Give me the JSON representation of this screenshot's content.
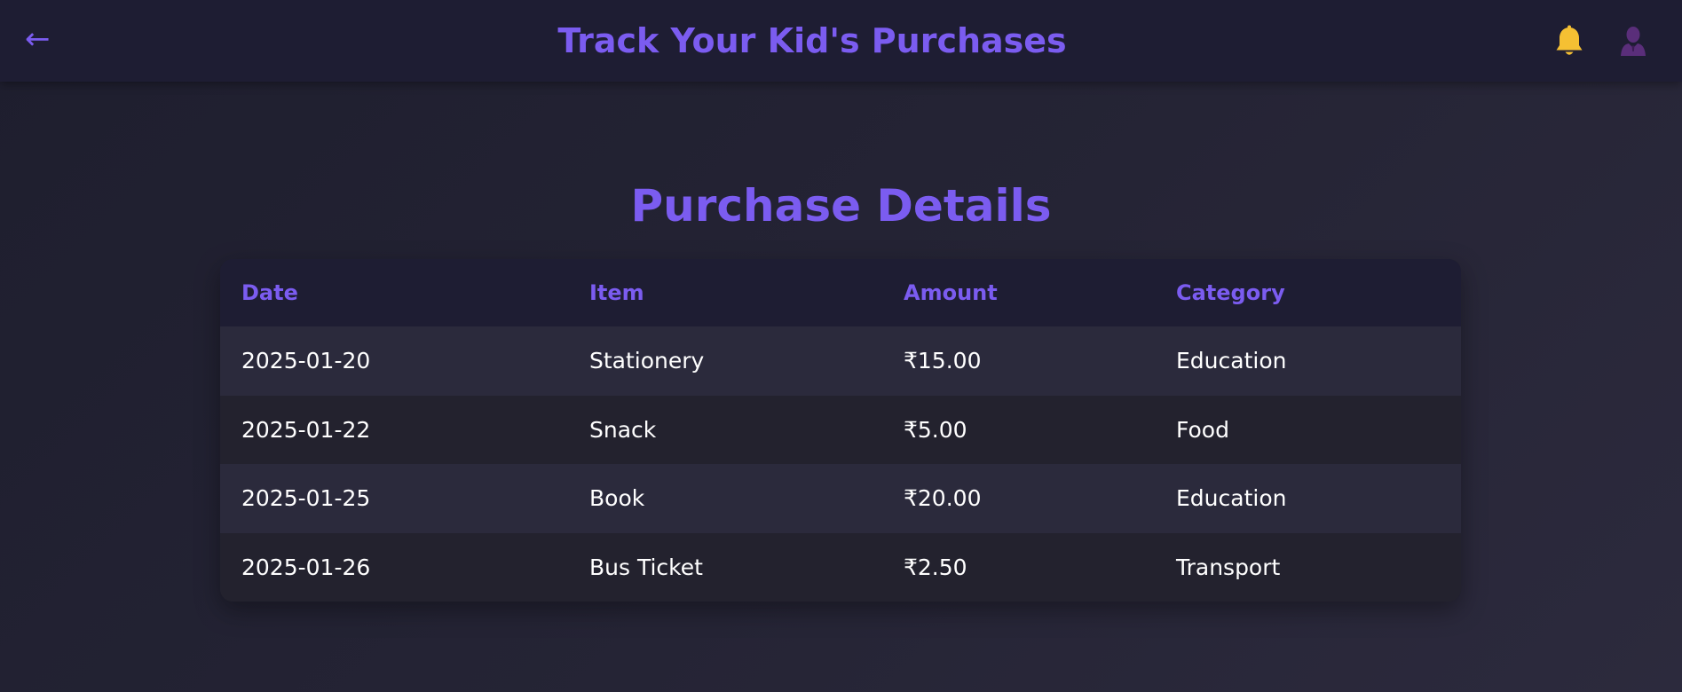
{
  "header": {
    "back_label": "←",
    "title": "Track Your Kid's Purchases",
    "icons": [
      "bell-icon",
      "user-icon"
    ]
  },
  "main": {
    "section_title": "Purchase Details",
    "table": {
      "columns": [
        "Date",
        "Item",
        "Amount",
        "Category"
      ],
      "rows": [
        [
          "2025-01-20",
          "Stationery",
          "₹15.00",
          "Education"
        ],
        [
          "2025-01-22",
          "Snack",
          "₹5.00",
          "Food"
        ],
        [
          "2025-01-25",
          "Book",
          "₹20.00",
          "Education"
        ],
        [
          "2025-01-26",
          "Bus Ticket",
          "₹2.50",
          "Transport"
        ]
      ]
    }
  },
  "colors": {
    "accent": "#7b5cf0",
    "header_bg": "#1e1d33",
    "row_odd": "#2b2a3c",
    "row_even": "#23222e",
    "bell": "#f5c033",
    "user": "#5a2e7a"
  }
}
